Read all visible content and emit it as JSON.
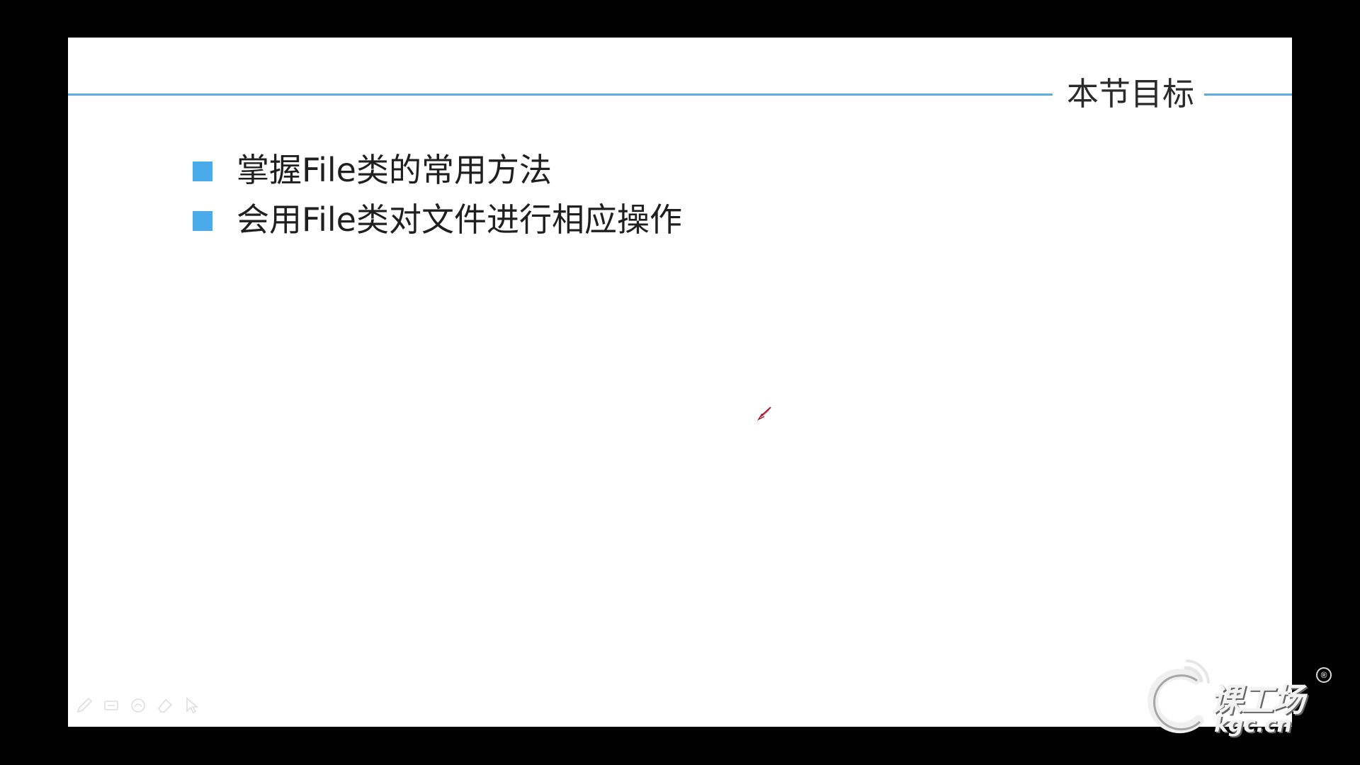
{
  "slide": {
    "title": "本节目标",
    "bullets": [
      "掌握File类的常用方法",
      "会用File类对文件进行相应操作"
    ],
    "accent_color": "#4aabea",
    "title_rule_color": "#5aaede"
  },
  "pen_toolbar": {
    "tools": [
      "pen-icon",
      "highlighter-icon",
      "ink-icon",
      "eraser-icon",
      "arrow-pointer-icon"
    ]
  },
  "watermark": {
    "brand_cn": "课工场",
    "brand_en": "kgc.cn",
    "registered": "®"
  }
}
